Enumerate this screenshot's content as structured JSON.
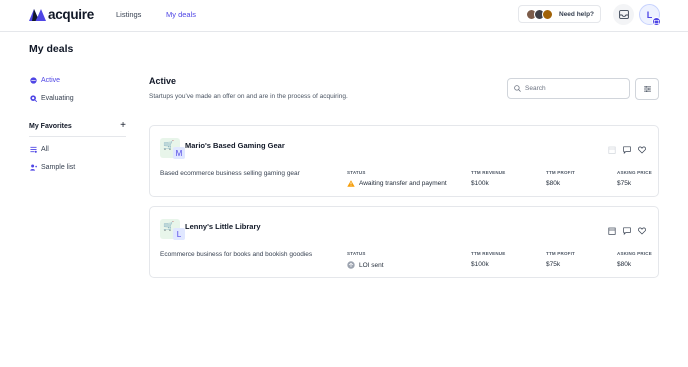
{
  "header": {
    "logo_text": "acquire",
    "nav": [
      {
        "label": "Listings"
      },
      {
        "label": "My deals"
      }
    ],
    "help_label": "Need help?",
    "user_initial": "L"
  },
  "page": {
    "title": "My deals"
  },
  "sidebar": {
    "items": [
      {
        "label": "Active"
      },
      {
        "label": "Evaluating"
      }
    ],
    "favorites_label": "My Favorites",
    "favorites_add": "+",
    "favorites": [
      {
        "label": "All"
      },
      {
        "label": "Sample list"
      }
    ]
  },
  "main": {
    "title": "Active",
    "subtitle": "Startups you've made an offer on and are in the process of acquiring.",
    "search_placeholder": "Search",
    "column_labels": {
      "status": "STATUS",
      "revenue": "TTM REVENUE",
      "profit": "TTM PROFIT",
      "price": "ASKING PRICE"
    },
    "deals": [
      {
        "name": "Mario's Based Gaming Gear",
        "logo_letter": "M",
        "description": "Based ecommerce business selling gaming gear",
        "status": "Awaiting transfer and payment",
        "revenue": "$100k",
        "profit": "$80k",
        "price": "$75k"
      },
      {
        "name": "Lenny's Little Library",
        "logo_letter": "L",
        "description": "Ecommerce business for books and bookish goodies",
        "status": "LOI sent",
        "revenue": "$100k",
        "profit": "$75k",
        "price": "$80k"
      }
    ]
  },
  "colors": {
    "accent": "#4f46e5",
    "warning": "#f59e0b",
    "muted": "#9ca3af"
  }
}
